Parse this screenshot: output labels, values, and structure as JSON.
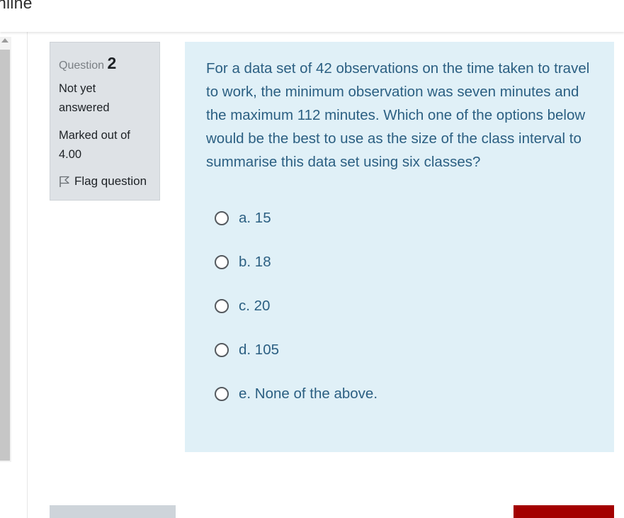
{
  "header": {
    "brand_text": "nline"
  },
  "info": {
    "question_label": "Question",
    "question_number": "2",
    "state_line1": "Not yet",
    "state_line2": "answered",
    "grade_line1": "Marked out of",
    "grade_line2": "4.00",
    "flag_label": "Flag question"
  },
  "question": {
    "text": "For a data set of 42 observations on the time taken to travel to work, the minimum observation was seven minutes and the maximum 112 minutes. Which one of the options below would be the best to use as the size of the class interval to summarise this data set using six classes?",
    "options": [
      {
        "label": "a. 15"
      },
      {
        "label": "b. 18"
      },
      {
        "label": "c. 20"
      },
      {
        "label": "d. 105"
      },
      {
        "label": "e. None of the above."
      }
    ]
  },
  "colors": {
    "info_bg": "#dee2e6",
    "question_bg": "#e0f0f7",
    "question_text": "#2b5f82",
    "next_button": "#a30000",
    "prev_button": "#ced4da"
  }
}
